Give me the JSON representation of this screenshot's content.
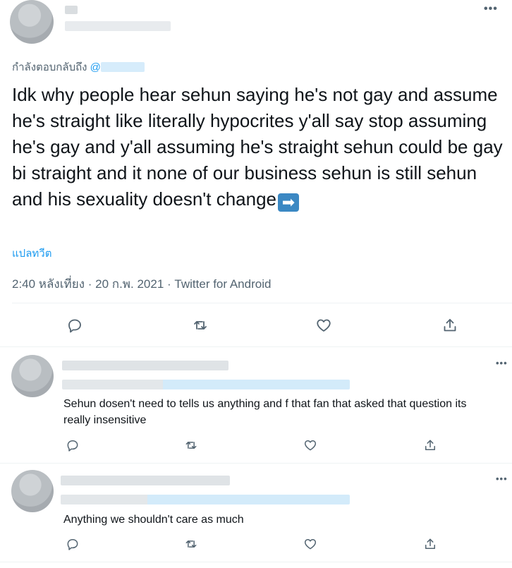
{
  "tweet": {
    "replying_to_label": "กำลังตอบกลับถึง",
    "replying_to_handle": "@",
    "text": "Idk why people hear sehun saying he's not gay and assume he's straight like literally hypocrites y'all say stop assuming he's gay and y'all assuming he's straight sehun could be gay bi straight and it none of our business sehun is still sehun and his sexuality doesn't change",
    "emoji": "➡",
    "translate_label": "แปลทวีต",
    "time": "2:40 หลังเที่ยง",
    "date": "20 ก.พ. 2021",
    "source": "Twitter for Android",
    "separator": "·"
  },
  "replies": [
    {
      "text": "Sehun dosen't need to tells us anything and f that fan that asked that question its really insensitive"
    },
    {
      "text": "Anything we shouldn't care as much"
    }
  ],
  "more_label": "•••",
  "icons": [
    "reply-icon",
    "retweet-icon",
    "like-icon",
    "share-icon",
    "more-icon"
  ]
}
